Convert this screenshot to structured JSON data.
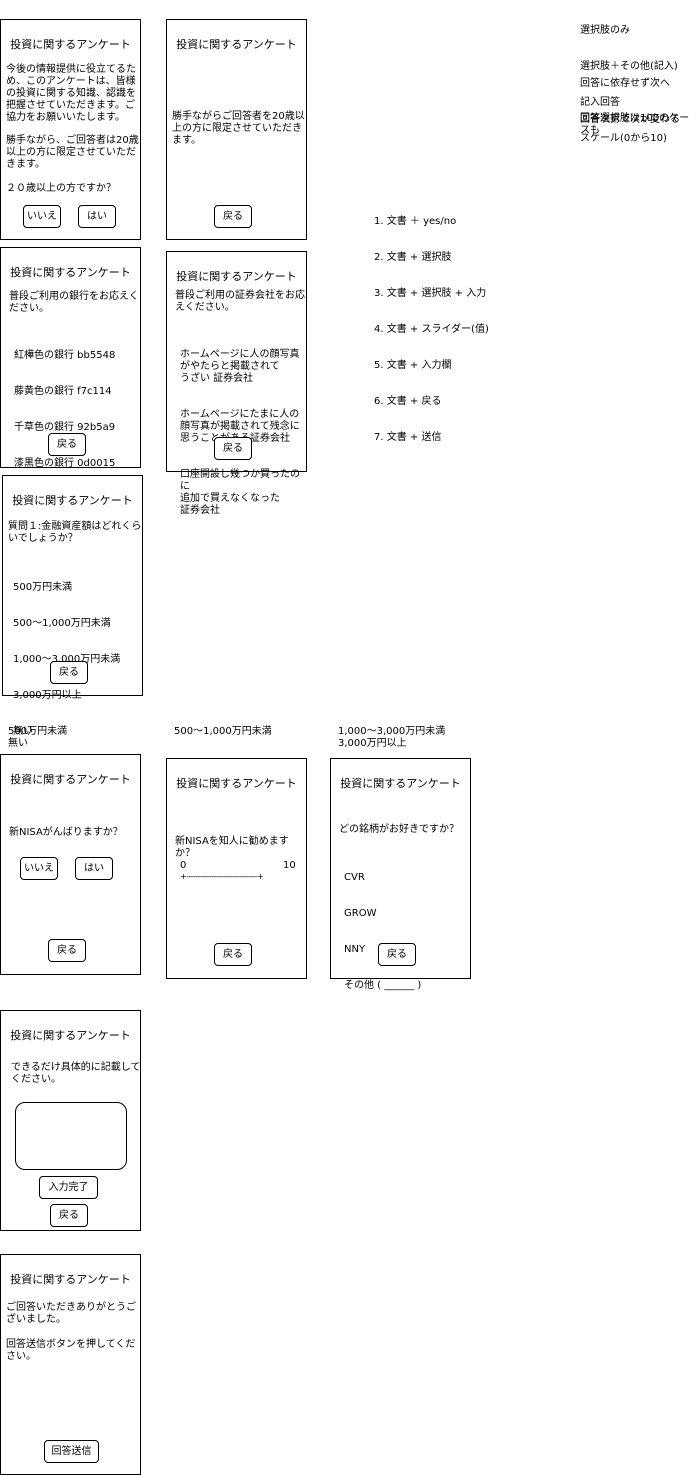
{
  "legend_right": {
    "group1": [
      "選択肢のみ",
      "選択肢＋その他(記入)",
      "記入回答",
      "スケール(0から10)"
    ],
    "group2": [
      "回答に依存せず次へ",
      "回答次第で次が変わる"
    ],
    "group3": [
      "回答選択肢は100のケースも"
    ]
  },
  "patterns": [
    "1. 文書 ＋ yes/no",
    "2. 文書 + 選択肢",
    "3. 文書 + 選択肢 + 入力",
    "4. 文書 + スライダー(值)",
    "5. 文書 + 入力欄",
    "6. 文書 + 戻る",
    "7. 文書 + 送信"
  ],
  "survey_title": "投資に関するアンケート",
  "back_label": "戻る",
  "screen1": {
    "intro": "今後の情報提供に役立てるため、このアンケートは、皆様の投資に関する知識、認識を把握させていただきます。ご協力をお願いいたします。",
    "restriction": "勝手ながら、ご回答者は20歳以上の方に限定させていただきます。",
    "question": "２０歳以上の方ですか？",
    "no": "いいえ",
    "yes": "はい"
  },
  "screen2": {
    "text": "勝手ながらご回答者を20歳以上の方に限定させていただきます。"
  },
  "screen3": {
    "question": "普段ご利用の銀行をお応えください。",
    "options": [
      "紅樺色の銀行 bb5548",
      "藤黄色の銀行 f7c114",
      "千草色の銀行 92b5a9",
      "漆黒色の銀行 0d0015"
    ]
  },
  "screen4": {
    "question": "普段ご利用の証券会社をお応えください。",
    "options": [
      "ホームページに人の顔写真\nがやたらと掲載されて\nうざい 証券会社",
      "ホームページにたまに人の\n顔写真が掲載されて残念に\n思うことがある証券会社",
      "口座開設し幾つか買ったのに\n追加で買えなくなった\n証券会社"
    ]
  },
  "screen5": {
    "question": "質問１:金融資産額はどれくらいでしょうか？",
    "options": [
      "500万円未満",
      "500〜1,000万円未満",
      "1,000〜3,000万円未満",
      "3,000万円以上",
      "無い"
    ]
  },
  "branch_labels": {
    "a": "500万円未満\n無い",
    "b": "500〜1,000万円未満",
    "c": "1,000〜3,000万円未満\n3,000万円以上"
  },
  "screen6": {
    "question": "新NISAがんばりますか？",
    "no": "いいえ",
    "yes": "はい"
  },
  "screen7": {
    "question": "新NISAを知人に勧めますか？",
    "min": "0",
    "max": "10",
    "track": "+-------------------------------+"
  },
  "screen8": {
    "question": "どの銘柄がお好きですか？",
    "options": [
      "CVR",
      "GROW",
      "NNY",
      "その他 ( ______ )"
    ]
  },
  "screen9": {
    "question": "できるだけ具体的に記載してください。",
    "submit": "入力完了"
  },
  "screen10": {
    "thanks": "ご回答いただきありがとうございました。",
    "instruction": "回答送信ボタンを押してください。",
    "send": "回答送信"
  }
}
